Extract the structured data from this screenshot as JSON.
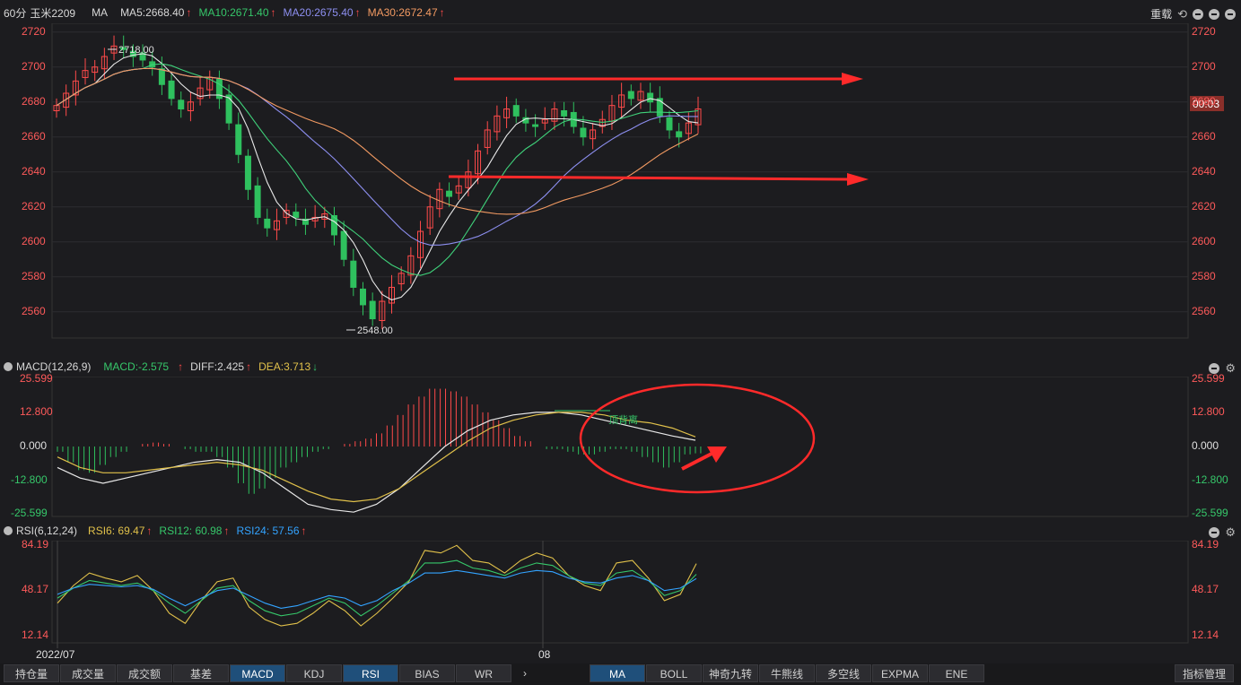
{
  "header": {
    "period": "60分",
    "symbol": "玉米2209",
    "indicator": "MA",
    "ma5": "MA5:2668.40",
    "ma10": "MA10:2671.40",
    "ma20": "MA20:2675.40",
    "ma30": "MA30:2672.47",
    "reload": "重载"
  },
  "main_chart": {
    "y_ticks": [
      "2720",
      "2700",
      "2680",
      "2660",
      "2640",
      "2620",
      "2600",
      "2580",
      "2560"
    ],
    "high_label": "2718.00",
    "low_label": "2548.00",
    "timer": "00:03"
  },
  "macd": {
    "title": "MACD(12,26,9)",
    "macd": "MACD:-2.575",
    "diff": "DIFF:2.425",
    "dea": "DEA:3.713",
    "y_ticks": [
      "25.599",
      "12.800",
      "0.000",
      "-12.800",
      "-25.599"
    ],
    "annotation": "顶背离"
  },
  "rsi": {
    "title": "RSI(6,12,24)",
    "rsi6": "RSI6: 69.47",
    "rsi12": "RSI12: 60.98",
    "rsi24": "RSI24: 57.56",
    "y_ticks": [
      "84.19",
      "48.17",
      "12.14"
    ]
  },
  "x_labels": {
    "start": "2022/07",
    "mid": "08"
  },
  "tabs_left": [
    "持仓量",
    "成交量",
    "成交额",
    "基差",
    "MACD",
    "KDJ",
    "RSI",
    "BIAS",
    "WR"
  ],
  "tabs_left_active": [
    "MACD",
    "RSI"
  ],
  "tabs_right": [
    "MA",
    "BOLL",
    "神奇九转",
    "牛熊线",
    "多空线",
    "EXPMA",
    "ENE"
  ],
  "tabs_right_active": [
    "MA"
  ],
  "manage_button": "指标管理",
  "colors": {
    "up": "#ff4a4a",
    "down": "#2fc05e",
    "ma5": "#e8e8e8",
    "ma10": "#3fd17a",
    "ma20": "#8d8ff0",
    "ma30": "#f29a62",
    "dea": "#e0c04a",
    "rsi6": "#e0c04a",
    "rsi12": "#36c76a",
    "rsi24": "#33a3ff",
    "annotation": "#ff2a2a"
  },
  "chart_data": [
    {
      "type": "candlestick",
      "title": "玉米2209 60分",
      "ylim": [
        2545,
        2725
      ],
      "high": 2718.0,
      "low": 2548.0,
      "close_trace": [
        2678,
        2685,
        2692,
        2698,
        2700,
        2706,
        2712,
        2710,
        2706,
        2704,
        2700,
        2690,
        2682,
        2676,
        2680,
        2688,
        2694,
        2682,
        2668,
        2650,
        2630,
        2614,
        2608,
        2612,
        2618,
        2614,
        2610,
        2614,
        2616,
        2604,
        2590,
        2574,
        2564,
        2556,
        2566,
        2574,
        2582,
        2592,
        2606,
        2620,
        2630,
        2626,
        2632,
        2640,
        2652,
        2664,
        2672,
        2676,
        2672,
        2668,
        2666,
        2670,
        2676,
        2672,
        2666,
        2660,
        2664,
        2670,
        2678,
        2684,
        2682,
        2686,
        2680,
        2672,
        2664,
        2660,
        2668,
        2676
      ]
    },
    {
      "type": "bar",
      "title": "MACD(12,26,9)",
      "ylim": [
        -25.599,
        25.599
      ],
      "macd_hist_trace": [
        -2,
        -6,
        -9,
        -10,
        -7,
        -4,
        -2,
        0,
        1,
        1.5,
        1,
        0,
        -1,
        -2,
        -2,
        -4,
        -8,
        -14,
        -18,
        -16,
        -12,
        -8,
        -6,
        -4,
        -2,
        -1,
        0,
        1,
        2,
        3,
        5,
        8,
        12,
        16,
        19,
        22,
        22,
        21,
        19,
        16,
        13,
        10,
        7,
        4,
        2,
        0,
        -1,
        -1,
        -2,
        -3,
        -3,
        -2,
        -1,
        -1,
        -2,
        -4,
        -6,
        -8,
        -6,
        -3,
        -2.6
      ],
      "diff_trace": [
        -8,
        -12,
        -14,
        -12,
        -10,
        -8,
        -6,
        -5,
        -6,
        -10,
        -16,
        -22,
        -24,
        -25,
        -22,
        -16,
        -8,
        0,
        6,
        10,
        12,
        13,
        13,
        12,
        10,
        8,
        6,
        4,
        2.4
      ],
      "dea_trace": [
        -4,
        -8,
        -10,
        -10,
        -9,
        -8,
        -7,
        -6,
        -7,
        -9,
        -13,
        -17,
        -20,
        -21,
        -20,
        -16,
        -10,
        -4,
        2,
        7,
        10,
        12,
        13,
        13,
        12,
        10,
        9,
        7,
        3.7
      ]
    },
    {
      "type": "line",
      "title": "RSI(6,12,24)",
      "ylim": [
        12.14,
        84.19
      ],
      "series": [
        {
          "name": "RSI6",
          "values": [
            38,
            52,
            62,
            58,
            55,
            60,
            48,
            30,
            22,
            40,
            55,
            58,
            35,
            25,
            20,
            22,
            30,
            40,
            32,
            20,
            30,
            42,
            55,
            80,
            78,
            84,
            72,
            70,
            62,
            72,
            78,
            74,
            60,
            52,
            48,
            70,
            72,
            58,
            40,
            45,
            69.47
          ]
        },
        {
          "name": "RSI12",
          "values": [
            42,
            50,
            56,
            54,
            52,
            54,
            48,
            38,
            30,
            40,
            50,
            52,
            40,
            32,
            28,
            30,
            36,
            42,
            38,
            28,
            36,
            46,
            56,
            70,
            70,
            72,
            66,
            64,
            60,
            66,
            70,
            68,
            60,
            54,
            52,
            62,
            64,
            56,
            44,
            48,
            60.98
          ]
        },
        {
          "name": "RSI24",
          "values": [
            45,
            50,
            53,
            52,
            51,
            52,
            49,
            42,
            36,
            42,
            48,
            50,
            44,
            38,
            34,
            36,
            40,
            44,
            42,
            36,
            40,
            48,
            54,
            62,
            62,
            64,
            62,
            60,
            58,
            62,
            64,
            63,
            58,
            55,
            54,
            58,
            60,
            56,
            48,
            50,
            57.56
          ]
        }
      ]
    }
  ]
}
